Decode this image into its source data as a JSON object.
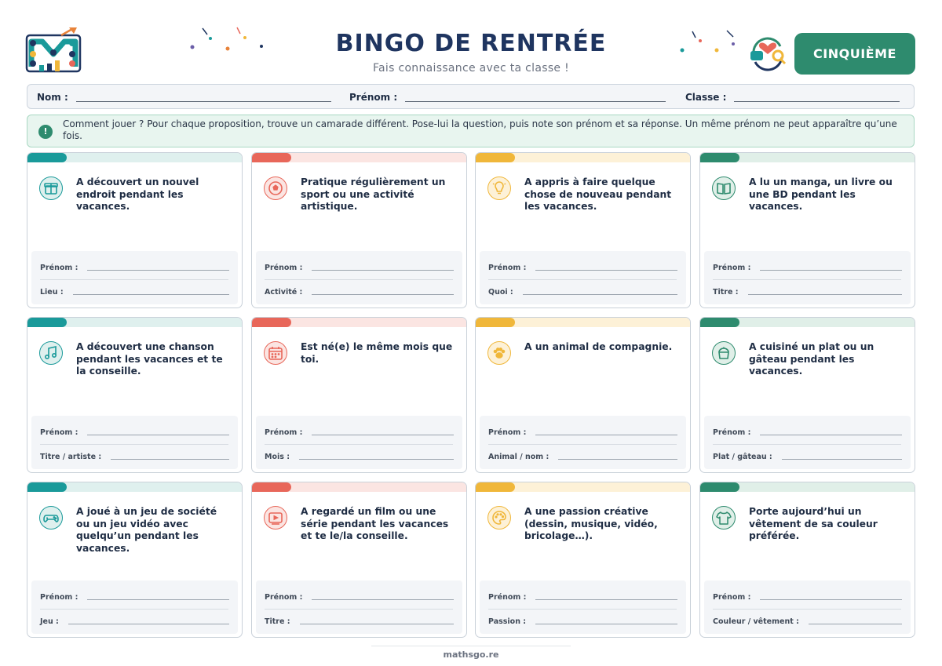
{
  "header": {
    "title": "BINGO DE RENTRÉE",
    "subtitle": "Fais connaissance avec ta classe !",
    "level": "CINQUIÈME"
  },
  "infobar": {
    "nom": "Nom :",
    "prenom": "Prénom :",
    "classe": "Classe :"
  },
  "notice": {
    "icon": "exclamation-icon",
    "text": "Comment jouer ? Pour chaque proposition, trouve un camarade différent. Pose-lui la question, puis note son prénom et sa réponse. Un même prénom ne peut apparaître qu’une fois."
  },
  "colors": {
    "teal": "#1a9a9a",
    "teal_light": "#dff0ee",
    "red": "#e8675a",
    "red_light": "#fbe5e2",
    "yellow": "#f0b73a",
    "yellow_light": "#fdf1d7",
    "green": "#2e8b6e",
    "green_light": "#e0efe8"
  },
  "cards": [
    {
      "question": "A découvert un nouvel endroit pendant les vacances.",
      "icon": "gift-icon",
      "label1": "Prénom :",
      "label2": "Lieu :"
    },
    {
      "question": "Pratique régulièrement un sport ou une activité artistique.",
      "icon": "ball-icon",
      "label1": "Prénom :",
      "label2": "Activité :"
    },
    {
      "question": "A appris à faire quelque chose de nouveau pendant les vacances.",
      "icon": "lightbulb-icon",
      "label1": "Prénom :",
      "label2": "Quoi :"
    },
    {
      "question": "A lu un manga, un livre ou une BD pendant les vacances.",
      "icon": "book-icon",
      "label1": "Prénom :",
      "label2": "Titre :"
    },
    {
      "question": "A découvert une chanson pendant les vacances et te la conseille.",
      "icon": "music-note-icon",
      "label1": "Prénom :",
      "label2": "Titre / artiste :"
    },
    {
      "question": "Est né(e) le même mois que toi.",
      "icon": "calendar-icon",
      "label1": "Prénom :",
      "label2": "Mois :"
    },
    {
      "question": "A un animal de compagnie.",
      "icon": "paw-icon",
      "label1": "Prénom :",
      "label2": "Animal / nom :"
    },
    {
      "question": "A cuisiné un plat ou un gâteau pendant les vacances.",
      "icon": "cooking-pot-icon",
      "label1": "Prénom :",
      "label2": "Plat / gâteau :"
    },
    {
      "question": "A joué à un jeu de société ou un jeu vidéo avec quelqu’un pendant les vacances.",
      "icon": "gamepad-icon",
      "label1": "Prénom :",
      "label2": "Jeu :"
    },
    {
      "question": "A regardé un film ou une série pendant les vacances et te le/la conseille.",
      "icon": "video-play-icon",
      "label1": "Prénom :",
      "label2": "Titre :"
    },
    {
      "question": "A une passion créative (dessin, musique, vidéo, bricolage…).",
      "icon": "palette-icon",
      "label1": "Prénom :",
      "label2": "Passion :"
    },
    {
      "question": "Porte aujourd’hui un vêtement de sa couleur préférée.",
      "icon": "tshirt-icon",
      "label1": "Prénom :",
      "label2": "Couleur / vêtement :"
    }
  ],
  "footer": "mathsgo.re"
}
